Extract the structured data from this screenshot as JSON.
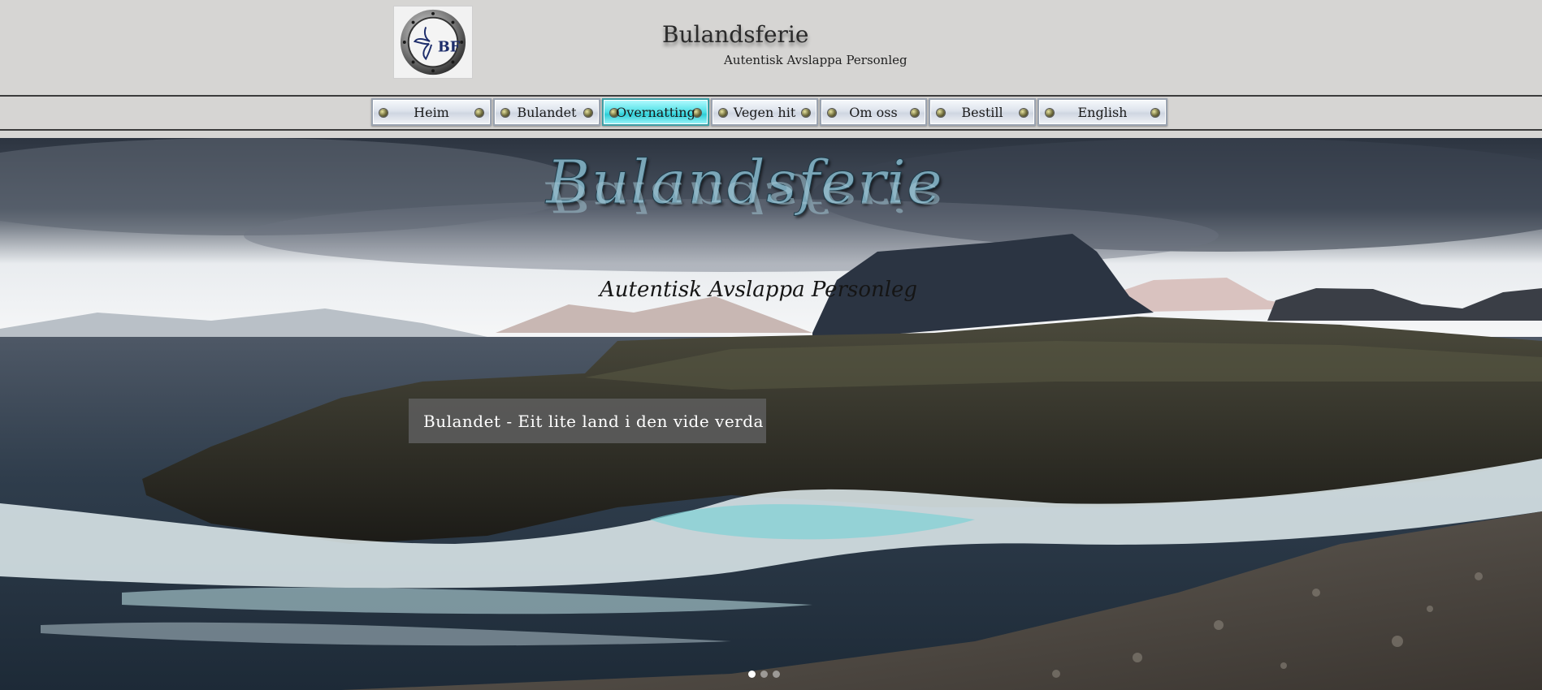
{
  "header": {
    "logo_text": "BF",
    "title": "Bulandsferie",
    "tagline": "Autentisk Avslappa Personleg"
  },
  "nav": {
    "items": [
      {
        "label": "Heim",
        "active": false
      },
      {
        "label": "Bulandet",
        "active": false
      },
      {
        "label": "Overnatting",
        "active": true
      },
      {
        "label": "Vegen hit",
        "active": false
      },
      {
        "label": "Om oss",
        "active": false
      },
      {
        "label": "Bestill",
        "active": false
      },
      {
        "label": "English",
        "active": false
      }
    ]
  },
  "hero": {
    "brand_title": "Bulandsferie",
    "script_tagline": "Autentisk Avslappa Personleg",
    "caption": "Bulandet - Eit lite land i den vide verda",
    "slide_count": 3,
    "active_slide": 1
  },
  "colors": {
    "page_background": "#d6d5d3",
    "active_nav": "#4fe0e6",
    "caption_background": "#5c5c5c"
  }
}
